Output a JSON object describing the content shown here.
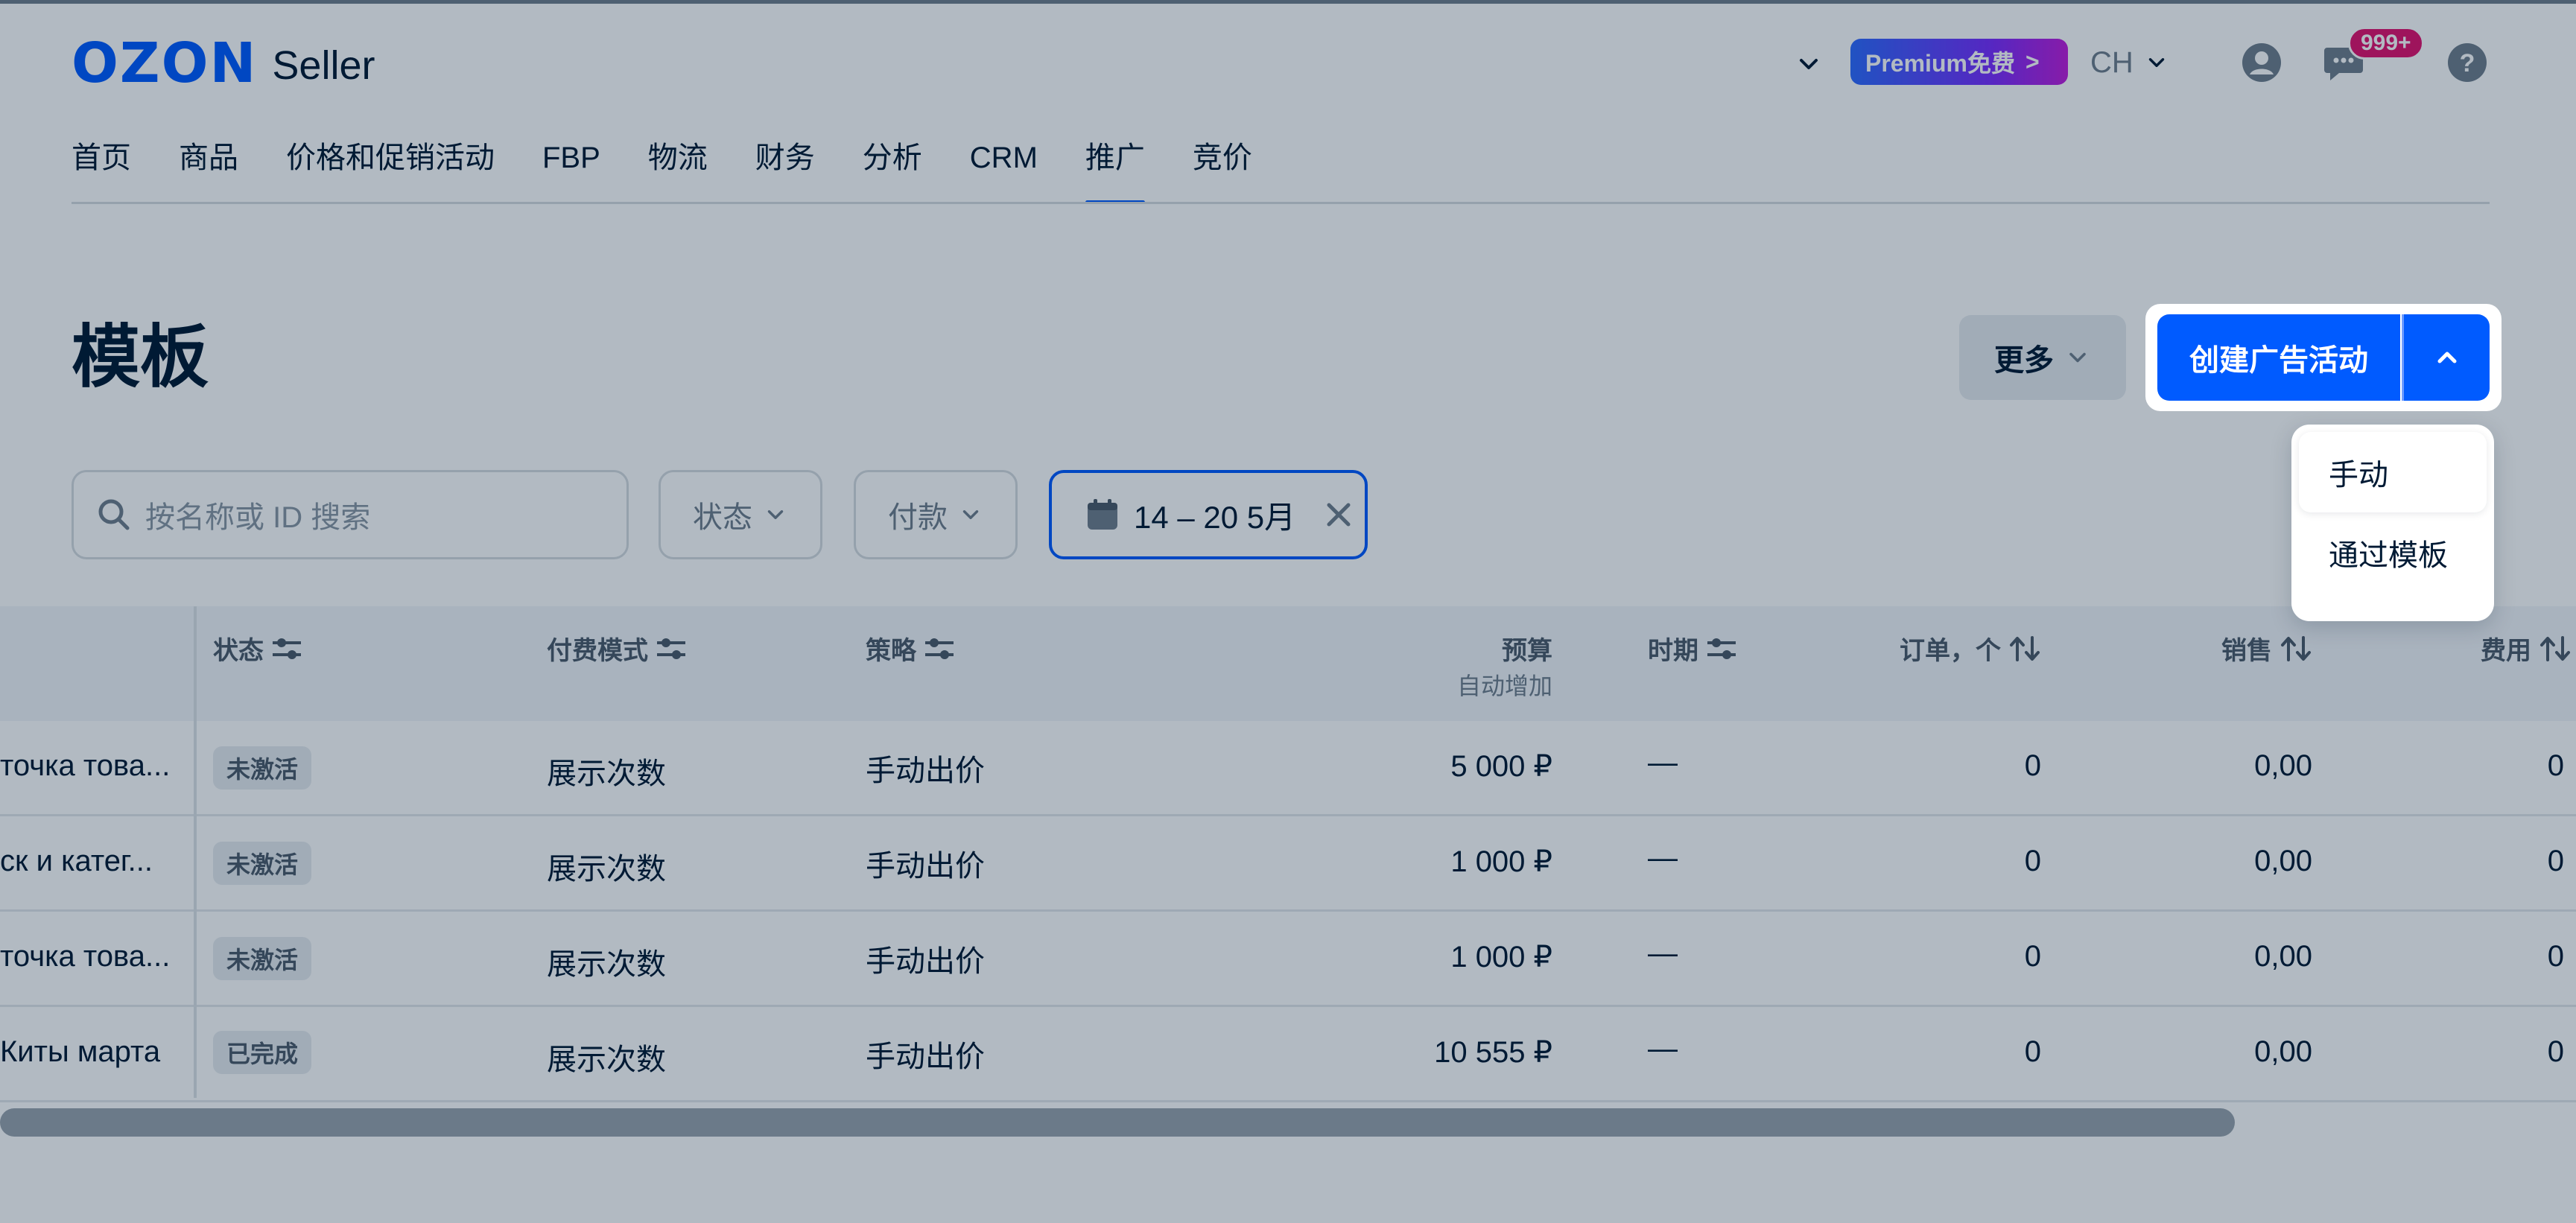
{
  "header": {
    "logo_brand": "OZON",
    "logo_product": "Seller",
    "premium_label": "Premium免费",
    "premium_arrow": ">",
    "language": "CH",
    "notifications_badge": "999+"
  },
  "nav": {
    "items": [
      {
        "label": "首页"
      },
      {
        "label": "商品"
      },
      {
        "label": "价格和促销活动"
      },
      {
        "label": "FBP"
      },
      {
        "label": "物流"
      },
      {
        "label": "财务"
      },
      {
        "label": "分析"
      },
      {
        "label": "CRM"
      },
      {
        "label": "推广",
        "active": true
      },
      {
        "label": "竞价"
      }
    ]
  },
  "page": {
    "title": "模板",
    "more_label": "更多",
    "create_label": "创建广告活动"
  },
  "create_menu": {
    "items": [
      {
        "label": "手动"
      },
      {
        "label": "通过模板"
      }
    ]
  },
  "filters": {
    "search_placeholder": "按名称或 ID 搜索",
    "status_label": "状态",
    "payment_label": "付款",
    "date_range": "14 – 20 5月"
  },
  "table": {
    "columns": {
      "status": "状态",
      "payment_model": "付费模式",
      "strategy": "策略",
      "budget": "预算",
      "budget_sub": "自动增加",
      "period": "时期",
      "orders": "订单，个",
      "sales": "销售",
      "cost": "费用"
    },
    "rows": [
      {
        "name": "точка това...",
        "status": "未激活",
        "payment_model": "展示次数",
        "strategy": "手动出价",
        "budget": "5 000 ₽",
        "period": "—",
        "orders": "0",
        "sales": "0,00",
        "cost": "0"
      },
      {
        "name": "ск и катег...",
        "status": "未激活",
        "payment_model": "展示次数",
        "strategy": "手动出价",
        "budget": "1 000 ₽",
        "period": "—",
        "orders": "0",
        "sales": "0,00",
        "cost": "0"
      },
      {
        "name": "точка това...",
        "status": "未激活",
        "payment_model": "展示次数",
        "strategy": "手动出价",
        "budget": "1 000 ₽",
        "period": "—",
        "orders": "0",
        "sales": "0,00",
        "cost": "0"
      },
      {
        "name": "Киты марта",
        "status": "已完成",
        "payment_model": "展示次数",
        "strategy": "手动出价",
        "budget": "10 555 ₽",
        "period": "—",
        "orders": "0",
        "sales": "0,00",
        "cost": "0"
      }
    ]
  },
  "colors": {
    "brand_blue": "#005bff",
    "badge_red": "#e3126e",
    "text_dark": "#001a34",
    "text_muted": "#707f8d"
  },
  "icons": {
    "header_chevron": "chevron-down-icon",
    "avatar": "user-circle-icon",
    "chat": "chat-bubble-icon",
    "help": "question-circle-icon",
    "search": "search-icon",
    "calendar": "calendar-icon",
    "clear": "close-icon",
    "filter_settings": "filter-settings-icon",
    "sort": "sort-arrows-icon"
  }
}
